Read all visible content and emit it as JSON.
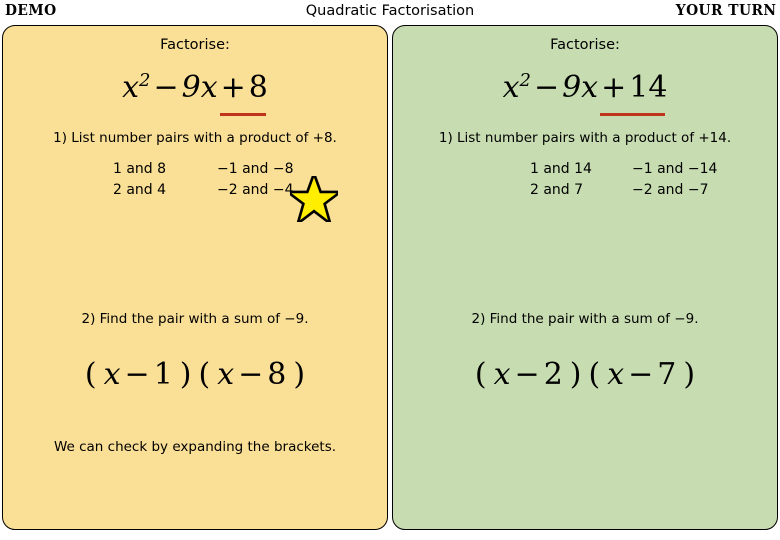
{
  "header": {
    "left_label": "DEMO",
    "title": "Quadratic Factorisation",
    "right_label": "YOUR TURN"
  },
  "colors": {
    "panel_left_bg": "#fadf96",
    "panel_right_bg": "#c7ddb1",
    "underline_red": "#c0341b",
    "star_fill": "#ffee00",
    "star_outline": "#000000",
    "border": "#000000"
  },
  "panels": [
    {
      "id": "demo",
      "factorise_label": "Factorise:",
      "equation": {
        "lead": "x",
        "power": "2",
        "middle_op": "−",
        "middle_term": "9x",
        "last_op": "+",
        "constant": "8",
        "underlined_part": "+ 8"
      },
      "step1": "1) List number pairs with a product of +8.",
      "pairs": [
        {
          "positive": "1  and 8",
          "negative": "−1 and −8"
        },
        {
          "positive": "2  and 4",
          "negative": "−2 and −4"
        }
      ],
      "starred_pair": "−1 and −8",
      "step2": "2) Find the pair with a sum of −9.",
      "result": {
        "open1": "(",
        "var1": "x",
        "op1": "−",
        "num1": "1",
        "close1": ")",
        "open2": "(",
        "var2": "x",
        "op2": "−",
        "num2": "8",
        "close2": ")"
      },
      "check_text": "We can check by expanding the brackets."
    },
    {
      "id": "your-turn",
      "factorise_label": "Factorise:",
      "equation": {
        "lead": "x",
        "power": "2",
        "middle_op": "−",
        "middle_term": "9x",
        "last_op": "+",
        "constant": "14",
        "underlined_part": "+ 14"
      },
      "step1": "1) List number pairs with a product of +14.",
      "pairs": [
        {
          "positive": "1  and 14",
          "negative": "−1 and −14"
        },
        {
          "positive": "2  and 7",
          "negative": "−2 and −7"
        }
      ],
      "starred_pair": "−2 and −7",
      "step2": "2) Find the pair with a sum of −9.",
      "result": {
        "open1": "(",
        "var1": "x",
        "op1": "−",
        "num1": "2",
        "close1": ")",
        "open2": "(",
        "var2": "x",
        "op2": "−",
        "num2": "7",
        "close2": ")"
      },
      "check_text": ""
    }
  ],
  "icons": {
    "star": "star-icon"
  }
}
